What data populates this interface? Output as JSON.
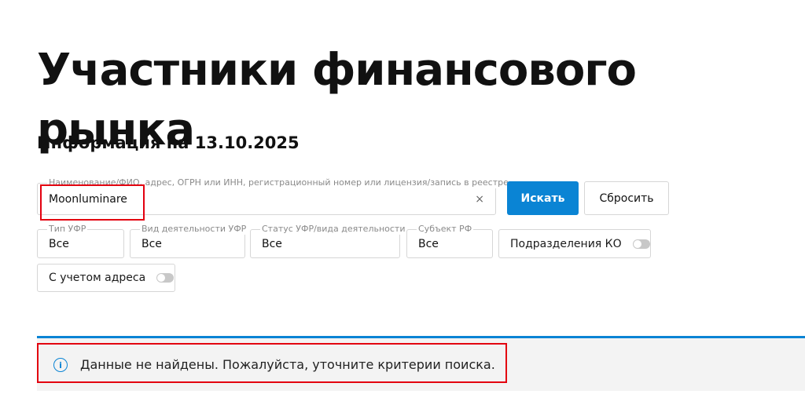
{
  "page": {
    "title": "Участники финансового рынка",
    "info_date": "Информация на 13.10.2025"
  },
  "search": {
    "label": "Наименование/ФИО, адрес, ОГРН или ИНН, регистрационный номер или лицензия/запись в реестре",
    "value": "Moonluminare",
    "clear_icon": "×",
    "submit_label": "Искать",
    "reset_label": "Сбросить"
  },
  "filters": {
    "type": {
      "label": "Тип УФР",
      "value": "Все"
    },
    "activity": {
      "label": "Вид деятельности УФР",
      "value": "Все"
    },
    "status": {
      "label": "Статус УФР/вида деятельности",
      "value": "Все"
    },
    "region": {
      "label": "Субъект РФ",
      "value": "Все"
    },
    "ko_divisions": {
      "label": "Подразделения КО",
      "enabled": false
    },
    "with_address": {
      "label": "С учетом адреса",
      "enabled": false
    }
  },
  "result": {
    "icon": "info-icon",
    "message": "Данные не найдены. Пожалуйста, уточните критерии поиска."
  },
  "colors": {
    "primary": "#0a84d4",
    "highlight": "#e3000f"
  }
}
